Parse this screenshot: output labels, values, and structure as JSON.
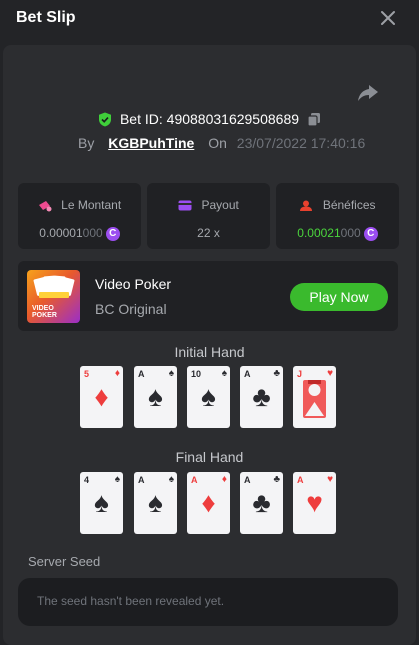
{
  "header": {
    "title": "Bet Slip",
    "close_icon": "close-icon"
  },
  "bet": {
    "id_label": "Bet ID: 4908803162950868 9",
    "id_text": "Bet ID: 4908803162950868",
    "by_label": "By",
    "user": "KGBPuhTine",
    "on_label": "On",
    "date": "23/07/2022 17:40:16"
  },
  "stats": [
    {
      "label": "Le Montant",
      "icon": "money-icon",
      "value_main": "0.00001",
      "value_dim": "000",
      "coin": "C",
      "color": "#ee4a8f"
    },
    {
      "label": "Payout",
      "icon": "card-icon",
      "value_main": "22 x",
      "color": "#9b4ef0"
    },
    {
      "label": "Bénéfices",
      "icon": "profit-icon",
      "value_main": "0.00021",
      "value_dim": "000",
      "coin": "C",
      "color": "#e8412e",
      "value_color": "#4bd43d"
    }
  ],
  "game": {
    "thumb_text_1": "VIDEO",
    "thumb_text_2": "POKER",
    "name": "Video Poker",
    "provider": "BC Original",
    "play_label": "Play Now"
  },
  "initial_hand": {
    "label": "Initial Hand",
    "cards": [
      {
        "rank": "5",
        "suit": "♦",
        "color": "red"
      },
      {
        "rank": "A",
        "suit": "♠",
        "color": "black"
      },
      {
        "rank": "10",
        "suit": "♠",
        "color": "black"
      },
      {
        "rank": "A",
        "suit": "♣",
        "color": "black"
      },
      {
        "rank": "J",
        "suit": "♥",
        "color": "red"
      }
    ]
  },
  "final_hand": {
    "label": "Final Hand",
    "cards": [
      {
        "rank": "4",
        "suit": "♠",
        "color": "black"
      },
      {
        "rank": "A",
        "suit": "♠",
        "color": "black"
      },
      {
        "rank": "A",
        "suit": "♦",
        "color": "red"
      },
      {
        "rank": "A",
        "suit": "♣",
        "color": "black"
      },
      {
        "rank": "A",
        "suit": "♥",
        "color": "red"
      }
    ]
  },
  "seed": {
    "label": "Server Seed",
    "placeholder": "The seed hasn't been revealed yet."
  }
}
